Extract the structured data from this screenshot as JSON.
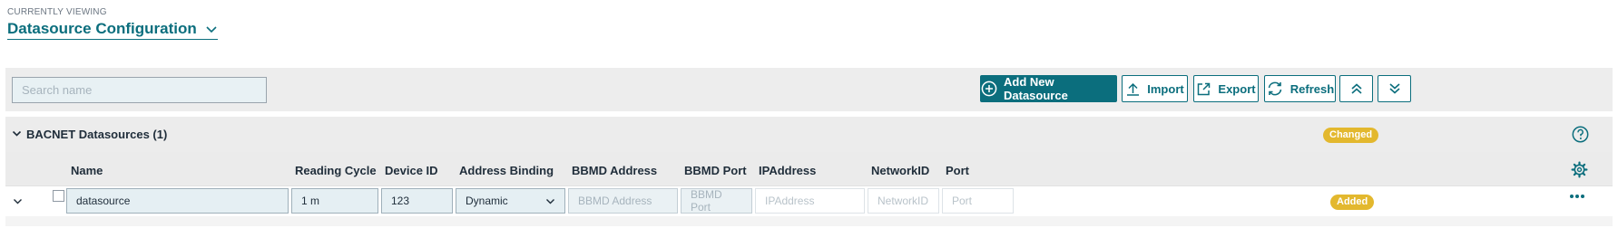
{
  "header": {
    "eyebrow": "CURRENTLY VIEWING",
    "title": "Datasource Configuration"
  },
  "toolbar": {
    "search_placeholder": "Search name",
    "add_label": "Add New Datasource",
    "import_label": "Import",
    "export_label": "Export",
    "refresh_label": "Refresh",
    "collapse_all_icon": "double-chevron-up-icon",
    "expand_all_icon": "double-chevron-down-icon"
  },
  "section": {
    "title": "BACNET Datasources (1)",
    "status_badge": "Changed",
    "help_icon": "help-icon"
  },
  "columns": [
    "Name",
    "Reading Cycle",
    "Device ID",
    "Address Binding",
    "BBMD Address",
    "BBMD Port",
    "IPAddress",
    "NetworkID",
    "Port"
  ],
  "rows": [
    {
      "name": "datasource",
      "reading_cycle": "1 m",
      "device_id": "123",
      "address_binding": "Dynamic",
      "bbmd_address_placeholder": "BBMD Address",
      "bbmd_port_placeholder": "BBMD Port",
      "ip_address_placeholder": "IPAddress",
      "network_id_placeholder": "NetworkID",
      "port_placeholder": "Port",
      "status_badge": "Added"
    }
  ],
  "colors": {
    "accent": "#0b6e7d",
    "badge": "#e3b82e"
  }
}
